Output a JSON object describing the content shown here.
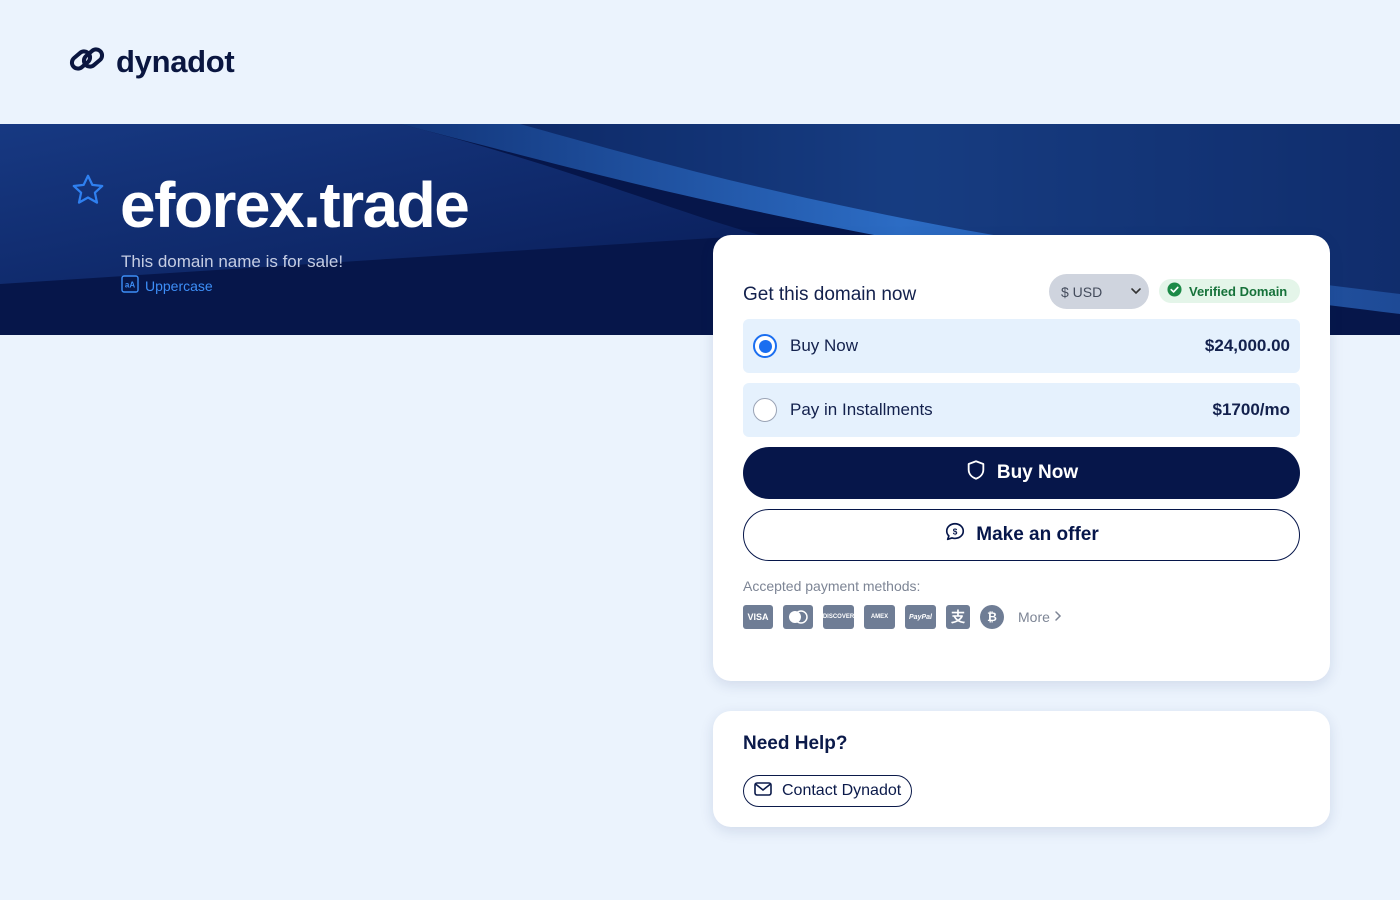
{
  "brand": {
    "name": "dynadot",
    "logo_icon": "chain-link-icon"
  },
  "hero": {
    "domain": "eforex.trade",
    "subtitle": "This domain name is for sale!",
    "uppercase_link": "Uppercase",
    "star_icon": "star-outline-icon"
  },
  "purchase": {
    "heading": "Get this domain now",
    "currency": "$ USD",
    "verified_label": "Verified Domain",
    "options": [
      {
        "label": "Buy Now",
        "price": "$24,000.00",
        "selected": true
      },
      {
        "label": "Pay in Installments",
        "price": "$1700/mo",
        "selected": false
      }
    ],
    "buy_button": "Buy Now",
    "offer_button": "Make an offer",
    "payment_label": "Accepted payment methods:",
    "payment_methods": [
      "VISA",
      "Mastercard",
      "Discover",
      "American Express",
      "PayPal",
      "Alipay",
      "Bitcoin"
    ],
    "more_label": "More"
  },
  "help": {
    "title": "Need Help?",
    "contact_button": "Contact Dynadot"
  },
  "colors": {
    "navy": "#06164a",
    "accent_blue": "#1a6ef0",
    "page_bg": "#ebf3fd",
    "verified_green": "#16723a"
  }
}
